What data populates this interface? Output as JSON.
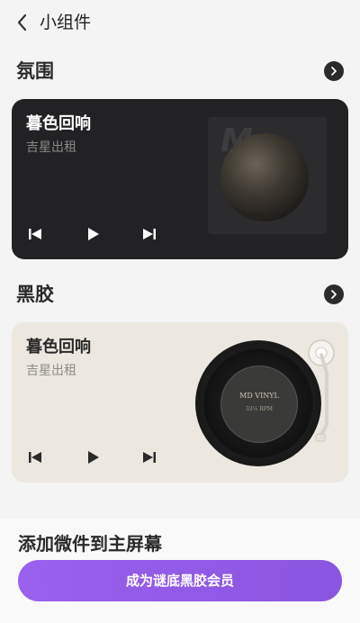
{
  "header": {
    "title": "小组件",
    "back_icon": "chevron-left-icon"
  },
  "sections": {
    "ambient": {
      "title": "氛围",
      "arrow_icon": "chevron-right-icon"
    },
    "vinyl": {
      "title": "黑胶",
      "arrow_icon": "chevron-right-icon"
    }
  },
  "widget_dark": {
    "song": "暮色回响",
    "artist": "吉星出租",
    "cover_mark": "M",
    "controls": [
      "previous-icon",
      "play-icon",
      "next-icon"
    ]
  },
  "widget_vinyl": {
    "song": "暮色回响",
    "artist": "吉星出租",
    "record_label_line1": "MD VINYL",
    "record_label_line2": "33⅓ RPM",
    "controls": [
      "previous-icon",
      "play-icon",
      "next-icon"
    ]
  },
  "footer": {
    "add_title": "添加微件到主屏幕",
    "cta_label": "成为谜底黑胶会员"
  },
  "colors": {
    "accent": "#9a60ee",
    "dark_card": "#222224",
    "light_card": "#ece8e0"
  }
}
